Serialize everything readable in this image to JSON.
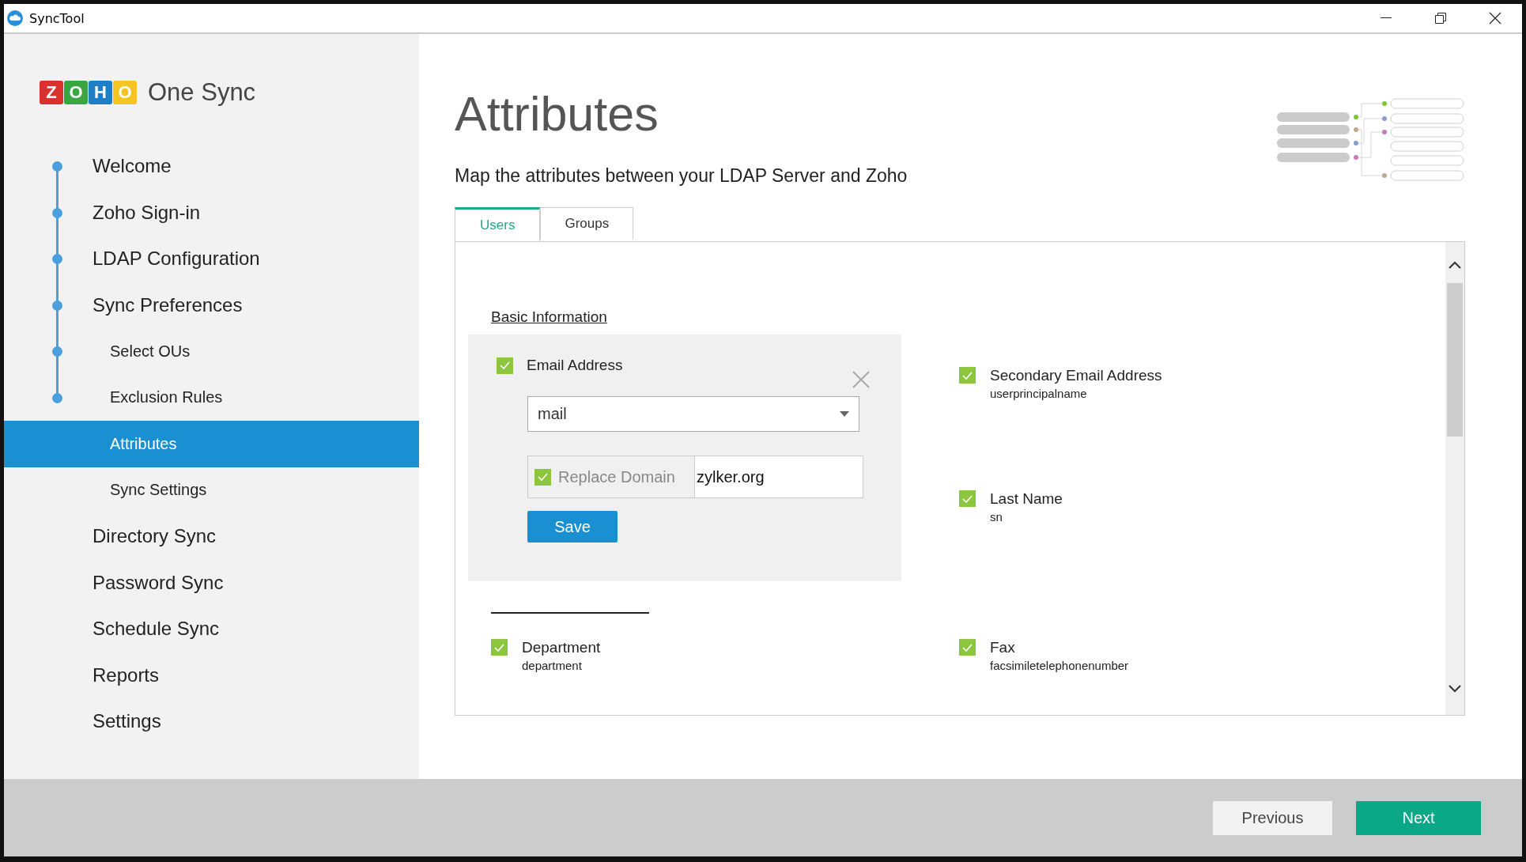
{
  "window": {
    "title": "SyncTool"
  },
  "brand": {
    "logo_letters": [
      "Z",
      "O",
      "H",
      "O"
    ],
    "name": "One Sync"
  },
  "sidebar": {
    "items": [
      {
        "label": "Welcome",
        "done": true,
        "selected": false
      },
      {
        "label": "Zoho Sign-in",
        "done": true,
        "selected": false
      },
      {
        "label": "LDAP Configuration",
        "done": true,
        "selected": false
      },
      {
        "label": "Sync Preferences",
        "done": true,
        "selected": false,
        "children": [
          {
            "label": "Select OUs",
            "done": true,
            "selected": false
          },
          {
            "label": "Exclusion Rules",
            "done": true,
            "selected": false
          },
          {
            "label": "Attributes",
            "done": false,
            "selected": true
          },
          {
            "label": "Sync Settings",
            "done": false,
            "selected": false
          }
        ]
      },
      {
        "label": "Directory Sync",
        "done": false,
        "selected": false
      },
      {
        "label": "Password Sync",
        "done": false,
        "selected": false
      },
      {
        "label": "Schedule Sync",
        "done": false,
        "selected": false
      },
      {
        "label": "Reports",
        "done": false,
        "selected": false
      },
      {
        "label": "Settings",
        "done": false,
        "selected": false
      }
    ]
  },
  "page": {
    "title": "Attributes",
    "subtitle": "Map the attributes between your LDAP Server and Zoho"
  },
  "tabs": [
    {
      "label": "Users",
      "selected": true
    },
    {
      "label": "Groups",
      "selected": false
    }
  ],
  "sections": [
    {
      "heading": "Basic Information",
      "fields": [
        {
          "label": "Secondary Email Address",
          "mapped": "userprincipalname",
          "checked": true
        },
        {
          "label": "Last Name",
          "mapped": "sn",
          "checked": true
        }
      ]
    },
    {
      "fields": [
        {
          "label": "Department",
          "mapped": "department",
          "checked": true
        },
        {
          "label": "Fax",
          "mapped": "facsimiletelephonenumber",
          "checked": true
        }
      ]
    }
  ],
  "editor": {
    "label": "Email Address",
    "checked": true,
    "value": "mail",
    "replace_domain": {
      "label": "Replace Domain",
      "checked": true,
      "value": "zylker.org"
    },
    "save": "Save"
  },
  "footer": {
    "buttons": [
      {
        "label": "Previous",
        "kind": "secondary"
      },
      {
        "label": "Next",
        "kind": "primary"
      }
    ]
  }
}
